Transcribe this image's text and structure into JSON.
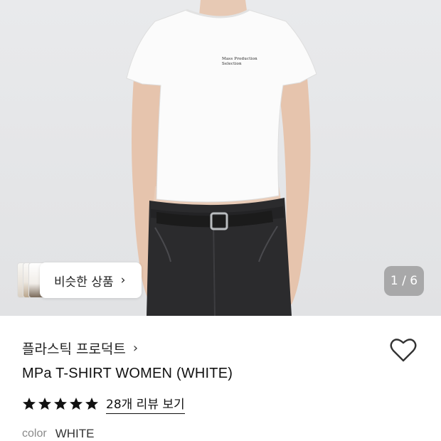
{
  "product_image": {
    "shirt_print": "Mass Production Selection",
    "counter": "1 / 6"
  },
  "similar": {
    "label": "비슷한 상품"
  },
  "brand": {
    "name": "플라스틱 프로덕트"
  },
  "product": {
    "name": "MPa T-SHIRT WOMEN (WHITE)"
  },
  "rating": {
    "stars": 5,
    "review_label": "28개 리뷰 보기"
  },
  "color": {
    "label": "color",
    "value": "WHITE"
  },
  "icons": {
    "chevron": "chevron-right-icon",
    "heart": "heart-outline-icon",
    "star": "star-filled-icon"
  }
}
